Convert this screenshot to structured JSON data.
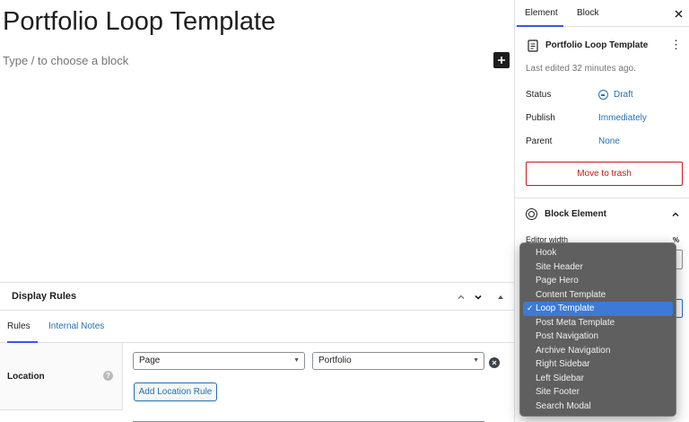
{
  "editor": {
    "title": "Portfolio Loop Template",
    "placeholder": "Type / to choose a block"
  },
  "display_rules": {
    "title": "Display Rules",
    "tabs": [
      {
        "label": "Rules",
        "active": true
      },
      {
        "label": "Internal Notes",
        "active": false
      }
    ],
    "location_label": "Location",
    "rule": {
      "type": "Page",
      "value": "Portfolio"
    },
    "add_button": "Add Location Rule"
  },
  "sidebar": {
    "tabs": [
      {
        "label": "Element",
        "active": true
      },
      {
        "label": "Block",
        "active": false
      }
    ],
    "document_title": "Portfolio Loop Template",
    "last_edited": "Last edited 32 minutes ago.",
    "meta": [
      {
        "label": "Status",
        "value": "Draft"
      },
      {
        "label": "Publish",
        "value": "Immediately"
      },
      {
        "label": "Parent",
        "value": "None"
      }
    ],
    "trash_button": "Move to trash",
    "block_element": {
      "title": "Block Element",
      "editor_width_label": "Editor width",
      "unit": "%"
    }
  },
  "element_type_menu": {
    "options": [
      "Hook",
      "Site Header",
      "Page Hero",
      "Content Template",
      "Loop Template",
      "Post Meta Template",
      "Post Navigation",
      "Archive Navigation",
      "Right Sidebar",
      "Left Sidebar",
      "Site Footer",
      "Search Modal"
    ],
    "selected": "Loop Template",
    "check_mark": "✓"
  },
  "colors": {
    "accent": "#3858e9",
    "link": "#2271b1",
    "danger": "#cc1818",
    "menu_bg": "#5f5f5f",
    "menu_selected": "#3d7ad6"
  }
}
